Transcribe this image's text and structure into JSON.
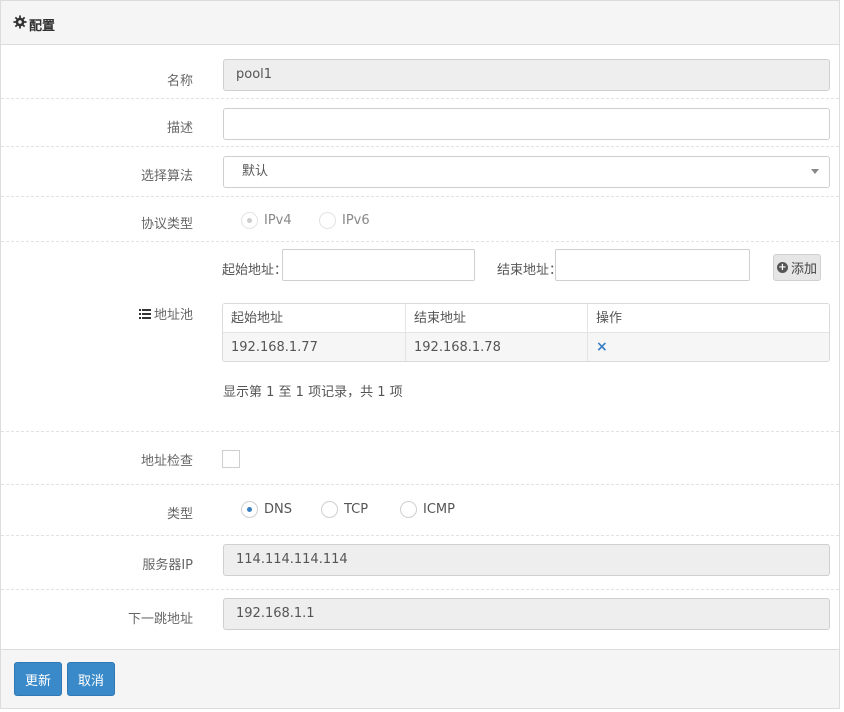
{
  "panel": {
    "title": "配置"
  },
  "form": {
    "name": {
      "label": "名称",
      "value": "pool1"
    },
    "description": {
      "label": "描述",
      "value": ""
    },
    "algorithm": {
      "label": "选择算法",
      "value": "默认"
    },
    "protocol": {
      "label": "协议类型",
      "options": [
        "IPv4",
        "IPv6"
      ],
      "selected": "IPv4",
      "disabled": true
    },
    "pool": {
      "label": "地址池",
      "start_label": "起始地址：",
      "end_label": "结束地址：",
      "add_label": "添加",
      "table": {
        "headers": [
          "起始地址",
          "结束地址",
          "操作"
        ],
        "rows": [
          {
            "start": "192.168.1.77",
            "end": "192.168.1.78",
            "action": "×"
          }
        ]
      },
      "info": "显示第 1 至 1 项记录，共 1 项"
    },
    "check": {
      "label": "地址检查",
      "checked": false
    },
    "type": {
      "label": "类型",
      "options": [
        "DNS",
        "TCP",
        "ICMP"
      ],
      "selected": "DNS"
    },
    "server_ip": {
      "label": "服务器IP",
      "value": "114.114.114.114"
    },
    "next_hop": {
      "label": "下一跳地址",
      "value": "192.168.1.1"
    }
  },
  "footer": {
    "update_label": "更新",
    "cancel_label": "取消"
  },
  "colors": {
    "primary": "#3a8ac9",
    "radio_on": "#3a7fc4"
  }
}
